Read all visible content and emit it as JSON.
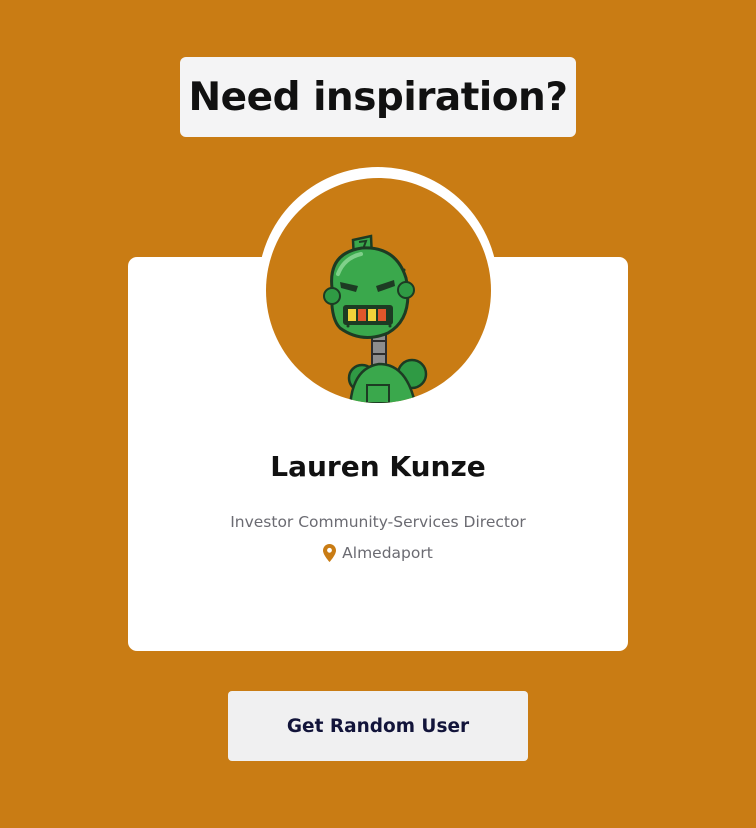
{
  "heading": {
    "text": "Need inspiration?"
  },
  "user": {
    "name": "Lauren Kunze",
    "title": "Investor Community-Services Director",
    "location": "Almedaport",
    "avatar_icon": "robot-avatar"
  },
  "actions": {
    "random_user_label": "Get Random User"
  },
  "colors": {
    "background": "#c97c14",
    "card": "#ffffff",
    "heading_box": "#f4f4f5",
    "button": "#f0f0f1",
    "button_text": "#12143a",
    "accent_pin": "#c97c14",
    "muted_text": "#6b6b72"
  }
}
